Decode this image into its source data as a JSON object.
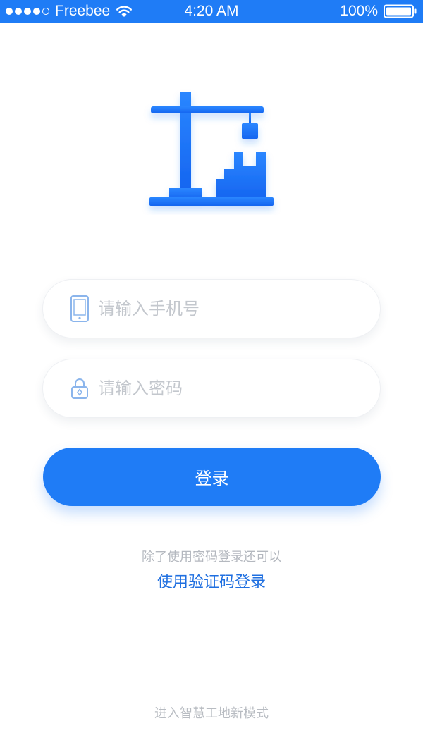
{
  "status_bar": {
    "signal_bars_filled": 4,
    "signal_bars_total": 5,
    "carrier": "Freebee",
    "time": "4:20 AM",
    "battery_percent": "100%",
    "background_color": "#1f7cf6"
  },
  "logo": {
    "icon": "construction-crane-logo",
    "color": "#1f7cf6"
  },
  "phone_field": {
    "icon": "phone-icon",
    "placeholder": "请输入手机号",
    "value": ""
  },
  "password_field": {
    "icon": "lock-icon",
    "placeholder": "请输入密码",
    "value": ""
  },
  "login_button": {
    "label": "登录",
    "color": "#1f7cf6"
  },
  "alt_login": {
    "hint": "除了使用密码登录还可以",
    "link": "使用验证码登录",
    "link_color": "#1f6fe0"
  },
  "footer": {
    "text": "进入智慧工地新模式"
  }
}
